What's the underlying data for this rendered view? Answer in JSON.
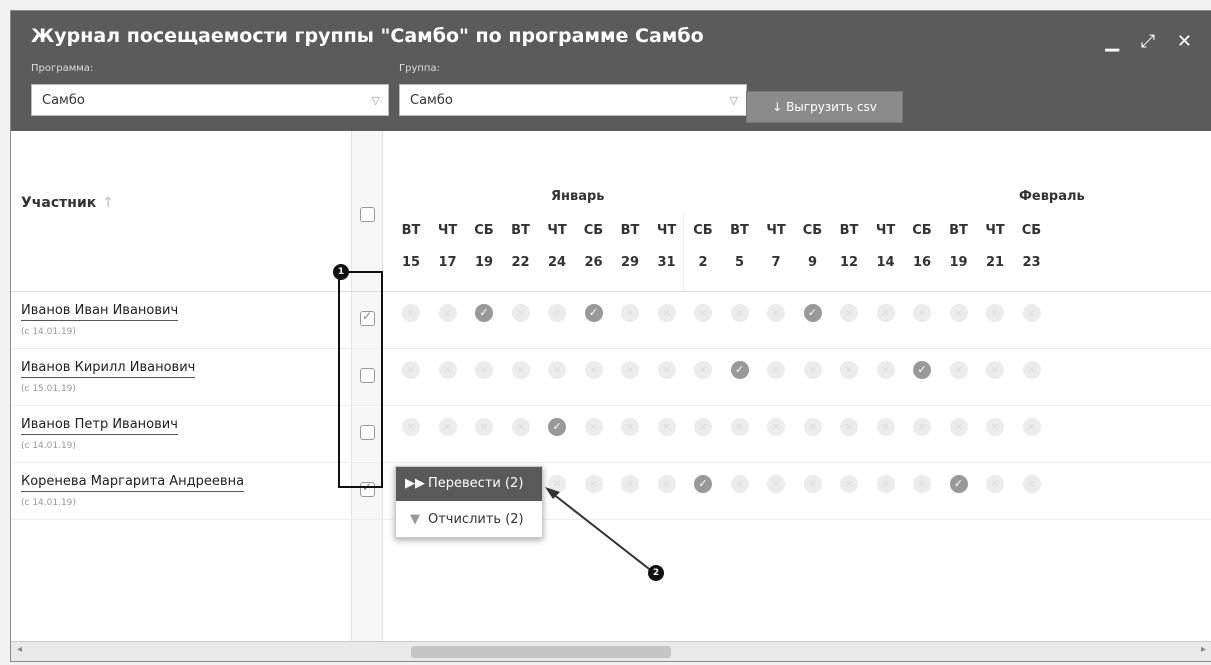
{
  "window": {
    "title": "Журнал посещаемости группы \"Самбо\" по программе Самбо",
    "controls": [
      "minimize-icon",
      "maximize-icon",
      "close-icon"
    ]
  },
  "filters": {
    "program_label": "Программа:",
    "program_value": "Самбо",
    "group_label": "Группа:",
    "group_value": "Самбо",
    "export_button": "Выгрузить csv"
  },
  "table": {
    "participant_header": "Участник",
    "months": [
      {
        "label": "Январь"
      },
      {
        "label": "Февраль"
      }
    ],
    "dates": [
      {
        "dow": "ВТ",
        "day": "15"
      },
      {
        "dow": "ЧТ",
        "day": "17"
      },
      {
        "dow": "СБ",
        "day": "19"
      },
      {
        "dow": "ВТ",
        "day": "22"
      },
      {
        "dow": "ЧТ",
        "day": "24"
      },
      {
        "dow": "СБ",
        "day": "26"
      },
      {
        "dow": "ВТ",
        "day": "29"
      },
      {
        "dow": "ЧТ",
        "day": "31"
      },
      {
        "dow": "СБ",
        "day": "2"
      },
      {
        "dow": "ВТ",
        "day": "5"
      },
      {
        "dow": "ЧТ",
        "day": "7"
      },
      {
        "dow": "СБ",
        "day": "9"
      },
      {
        "dow": "ВТ",
        "day": "12"
      },
      {
        "dow": "ЧТ",
        "day": "14"
      },
      {
        "dow": "СБ",
        "day": "16"
      },
      {
        "dow": "ВТ",
        "day": "19"
      },
      {
        "dow": "ЧТ",
        "day": "21"
      },
      {
        "dow": "СБ",
        "day": "23"
      }
    ],
    "rows": [
      {
        "name": "Иванов Иван Иванович",
        "since": "(с 14.01.19)",
        "checked": true,
        "attendance": [
          0,
          0,
          1,
          0,
          0,
          1,
          0,
          0,
          0,
          0,
          0,
          1,
          0,
          0,
          0,
          0,
          0,
          0
        ]
      },
      {
        "name": "Иванов Кирилл Иванович",
        "since": "(с 15.01.19)",
        "checked": false,
        "attendance": [
          0,
          0,
          0,
          0,
          0,
          0,
          0,
          0,
          0,
          1,
          0,
          0,
          0,
          0,
          1,
          0,
          0,
          0
        ]
      },
      {
        "name": "Иванов Петр Иванович",
        "since": "(с 14.01.19)",
        "checked": false,
        "attendance": [
          0,
          0,
          0,
          0,
          1,
          0,
          0,
          0,
          0,
          0,
          0,
          0,
          0,
          0,
          0,
          0,
          0,
          0
        ]
      },
      {
        "name": "Коренева Маргарита Андреевна",
        "since": "(с 14.01.19)",
        "checked": true,
        "attendance": [
          0,
          0,
          0,
          0,
          0,
          0,
          0,
          0,
          1,
          0,
          0,
          0,
          0,
          0,
          0,
          1,
          0,
          0
        ]
      }
    ]
  },
  "context_menu": {
    "transfer": "Перевести (2)",
    "expel": "Отчислить (2)"
  },
  "annotations": {
    "badge1": "1",
    "badge2": "2"
  }
}
